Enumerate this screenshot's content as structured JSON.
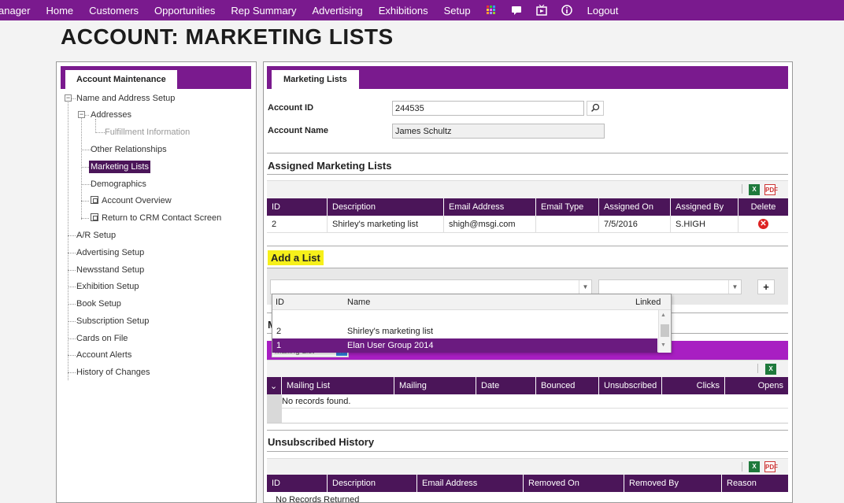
{
  "nav": {
    "items": [
      "anager",
      "Home",
      "Customers",
      "Opportunities",
      "Rep Summary",
      "Advertising",
      "Exhibitions",
      "Setup"
    ],
    "icons": [
      "grid-icon",
      "chat-icon",
      "media-icon",
      "info-icon"
    ],
    "logout": "Logout",
    "bg_color": "#7a1a8e"
  },
  "page": {
    "title": "ACCOUNT: MARKETING LISTS"
  },
  "left": {
    "tab": "Account Maintenance",
    "tree": {
      "name_address": "Name and Address Setup",
      "addresses": "Addresses",
      "fulfillment": "Fulfillment Information",
      "other_rel": "Other Relationships",
      "marketing_lists": "Marketing Lists",
      "demographics": "Demographics",
      "account_overview": "Account Overview",
      "return_crm": "Return to CRM Contact Screen",
      "ar_setup": "A/R Setup",
      "advertising_setup": "Advertising Setup",
      "newsstand_setup": "Newsstand Setup",
      "exhibition_setup": "Exhibition Setup",
      "book_setup": "Book Setup",
      "subscription_setup": "Subscription Setup",
      "cards_on_file": "Cards on File",
      "account_alerts": "Account Alerts",
      "history_changes": "History of Changes"
    }
  },
  "right": {
    "tab": "Marketing Lists",
    "account_id_label": "Account ID",
    "account_id_value": "244535",
    "account_name_label": "Account Name",
    "account_name_value": "James Schultz",
    "assigned": {
      "title": "Assigned Marketing Lists",
      "columns": [
        "ID",
        "Description",
        "Email Address",
        "Email Type",
        "Assigned On",
        "Assigned By",
        "Delete"
      ],
      "rows": [
        {
          "id": "2",
          "description": "Shirley's marketing list",
          "email": "shigh@msgi.com",
          "email_type": "",
          "assigned_on": "7/5/2016",
          "assigned_by": "S.HIGH"
        }
      ]
    },
    "add_list": {
      "title": "Add a List",
      "plus": "+",
      "dropdown_columns": [
        "ID",
        "Name",
        "Linked"
      ],
      "dropdown_rows": [
        {
          "id": "2",
          "name": "Shirley's marketing list",
          "linked": ""
        },
        {
          "id": "1",
          "name": "Elan User Group 2014",
          "linked": ""
        }
      ]
    },
    "mailings": {
      "partial_title": "M",
      "filter_label": "Mailing List",
      "columns": [
        "Mailing List",
        "Mailing",
        "Date",
        "Bounced",
        "Unsubscribed",
        "Clicks",
        "Opens"
      ],
      "empty": "No records found."
    },
    "unsubscribed": {
      "title": "Unsubscribed History",
      "columns": [
        "ID",
        "Description",
        "Email Address",
        "Removed On",
        "Removed By",
        "Reason"
      ],
      "empty": "No Records Returned"
    }
  }
}
